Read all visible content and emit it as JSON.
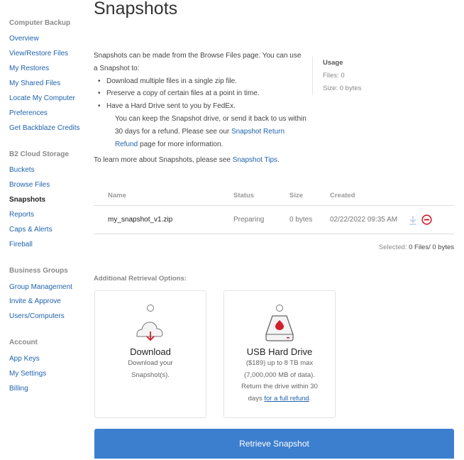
{
  "sidebar": {
    "sections": [
      {
        "title": "Computer Backup",
        "items": [
          "Overview",
          "View/Restore Files",
          "My Restores",
          "My Shared Files",
          "Locate My Computer",
          "Preferences",
          "Get Backblaze Credits"
        ]
      },
      {
        "title": "B2 Cloud Storage",
        "items": [
          "Buckets",
          "Browse Files",
          "Snapshots",
          "Reports",
          "Caps & Alerts",
          "Fireball"
        ]
      },
      {
        "title": "Business Groups",
        "items": [
          "Group Management",
          "Invite & Approve",
          "Users/Computers"
        ]
      },
      {
        "title": "Account",
        "items": [
          "App Keys",
          "My Settings",
          "Billing"
        ]
      }
    ],
    "active": "Snapshots"
  },
  "page_title": "Snapshots",
  "intro": {
    "line1": "Snapshots can be made from the Browse Files page. You can use a Snapshot to:",
    "bullets": [
      "Download multiple files in a single zip file.",
      "Preserve a copy of certain files at a point in time.",
      "Have a Hard Drive sent to you by FedEx."
    ],
    "cont_pre": "You can keep the Snapshot drive, or send it back to us within 30 days for a refund. Please see our ",
    "cont_link": "Snapshot Return Refund",
    "cont_post": " page for more information.",
    "tips_pre": "To learn more about Snapshots, please see ",
    "tips_link": "Snapshot Tips",
    "tips_post": "."
  },
  "usage": {
    "title": "Usage",
    "files": "Files: 0",
    "size": "Size: 0 bytes"
  },
  "table": {
    "headers": [
      "Name",
      "Status",
      "Size",
      "Created"
    ],
    "rows": [
      {
        "name": "my_snapshot_v1.zip",
        "status": "Preparing",
        "size": "0 bytes",
        "created": "02/22/2022 09:35 AM"
      }
    ]
  },
  "selected": {
    "label": "Selected:",
    "value": "0 Files/ 0 bytes"
  },
  "additional_title": "Additional Retrieval Options:",
  "options": [
    {
      "title": "Download",
      "desc": "Download your Snapshot(s)."
    },
    {
      "title": "USB Hard Drive",
      "desc_pre": "($189) up to 8 TB max (7,000,000 MB of data). Return the drive within 30 days ",
      "desc_link": "for a full refund",
      "desc_post": "."
    }
  ],
  "retrieve_button": "Retrieve Snapshot",
  "colors": {
    "link": "#1f63ad",
    "button": "#3d7fcf",
    "accent_red": "#d0202e"
  }
}
